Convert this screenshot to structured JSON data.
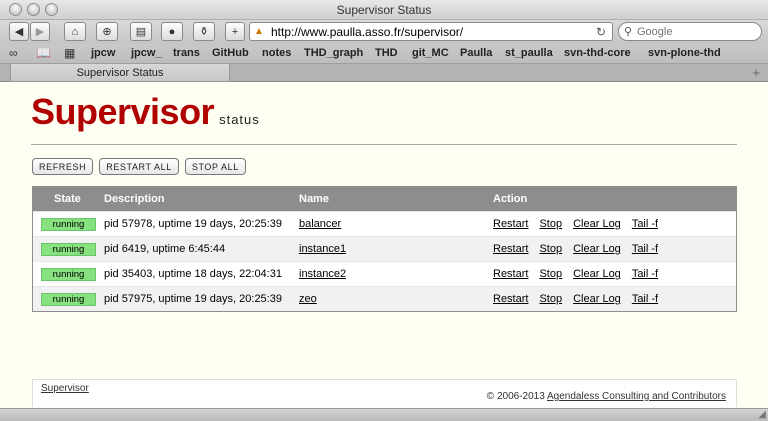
{
  "window": {
    "title": "Supervisor Status"
  },
  "toolbar": {
    "back_icon": "back-arrow-icon",
    "forward_icon": "forward-arrow-icon",
    "home_icon": "home-icon",
    "url": "http://www.paulla.asso.fr/supervisor/",
    "search_placeholder": "Google"
  },
  "bookmarks": {
    "items": [
      "jpcw",
      "jpcw_",
      "trans",
      "GitHub",
      "notes",
      "THD_graph",
      "THD",
      "git_MC",
      "Paulla",
      "st_paulla",
      "svn-thd-core",
      "svn-plone-thd"
    ]
  },
  "tab": {
    "title": "Supervisor Status"
  },
  "header": {
    "logo_main": "Supervisor",
    "logo_sub": "status"
  },
  "actions": {
    "refresh": "REFRESH",
    "restart_all": "RESTART ALL",
    "stop_all": "STOP ALL"
  },
  "table": {
    "headers": {
      "state": "State",
      "description": "Description",
      "name": "Name",
      "action": "Action"
    },
    "action_labels": {
      "restart": "Restart",
      "stop": "Stop",
      "clear_log": "Clear Log",
      "tail": "Tail -f"
    },
    "rows": [
      {
        "state": "running",
        "description": "pid 57978, uptime 19 days, 20:25:39",
        "name": "balancer"
      },
      {
        "state": "running",
        "description": "pid 6419, uptime 6:45:44",
        "name": "instance1"
      },
      {
        "state": "running",
        "description": "pid 35403, uptime 18 days, 22:04:31",
        "name": "instance2"
      },
      {
        "state": "running",
        "description": "pid 57975, uptime 19 days, 20:25:39",
        "name": "zeo"
      }
    ]
  },
  "footer": {
    "left_link": "Supervisor",
    "copyright": "© 2006-2013",
    "right_link": "Agendaless Consulting and Contributors"
  },
  "colors": {
    "brand_red": "#b00000",
    "running_green": "#87e17f",
    "header_grey": "#8d8d8d"
  }
}
